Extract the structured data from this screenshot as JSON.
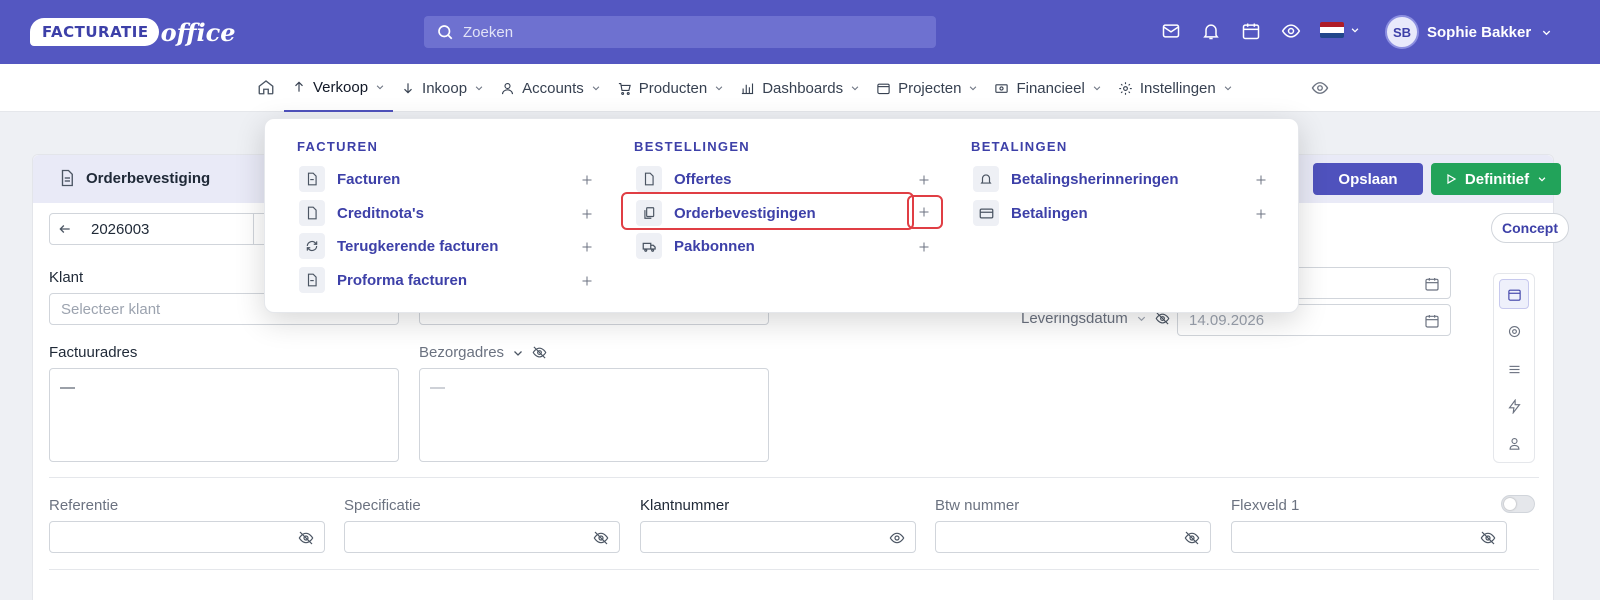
{
  "header": {
    "logo_text": "FACTURATIE",
    "logo_text2": "office",
    "search_placeholder": "Zoeken",
    "user_initials": "SB",
    "user_name": "Sophie Bakker"
  },
  "nav": {
    "items": [
      {
        "label": "Verkoop",
        "icon": "arrow-up-icon",
        "active": true
      },
      {
        "label": "Inkoop",
        "icon": "arrow-down-icon"
      },
      {
        "label": "Accounts",
        "icon": "user-icon"
      },
      {
        "label": "Producten",
        "icon": "cart-icon"
      },
      {
        "label": "Dashboards",
        "icon": "bar-chart-icon"
      },
      {
        "label": "Projecten",
        "icon": "folder-icon"
      },
      {
        "label": "Financieel",
        "icon": "cash-icon"
      },
      {
        "label": "Instellingen",
        "icon": "gear-icon"
      }
    ]
  },
  "menu": {
    "facturen": {
      "heading": "FACTUREN",
      "items": [
        "Facturen",
        "Creditnota's",
        "Terugkerende facturen",
        "Proforma facturen"
      ]
    },
    "bestellingen": {
      "heading": "BESTELLINGEN",
      "items": [
        "Offertes",
        "Orderbevestigingen",
        "Pakbonnen"
      ]
    },
    "betalingen": {
      "heading": "BETALINGEN",
      "items": [
        "Betalingsherinneringen",
        "Betalingen"
      ]
    }
  },
  "card": {
    "title": "Orderbevestiging",
    "save_label": "Opslaan",
    "final_label": "Definitief",
    "status": "Concept",
    "number": "2026003"
  },
  "form": {
    "klant_label": "Klant",
    "klant_placeholder": "Selecteer klant",
    "factuuradres_label": "Factuuradres",
    "factuuradres_value": "—",
    "bezorgadres_label": "Bezorgadres",
    "bezorgadres_value": "—",
    "leveringsdatum_label": "Leveringsdatum",
    "leveringsdatum_value": "14.09.2026",
    "referentie_label": "Referentie",
    "specificatie_label": "Specificatie",
    "klantnummer_label": "Klantnummer",
    "btw_label": "Btw nummer",
    "flexveld_label": "Flexveld 1"
  },
  "colors": {
    "primary": "#5457c1",
    "accent": "#3d40a8",
    "success": "#22a35a",
    "highlight": "#e03e44"
  }
}
